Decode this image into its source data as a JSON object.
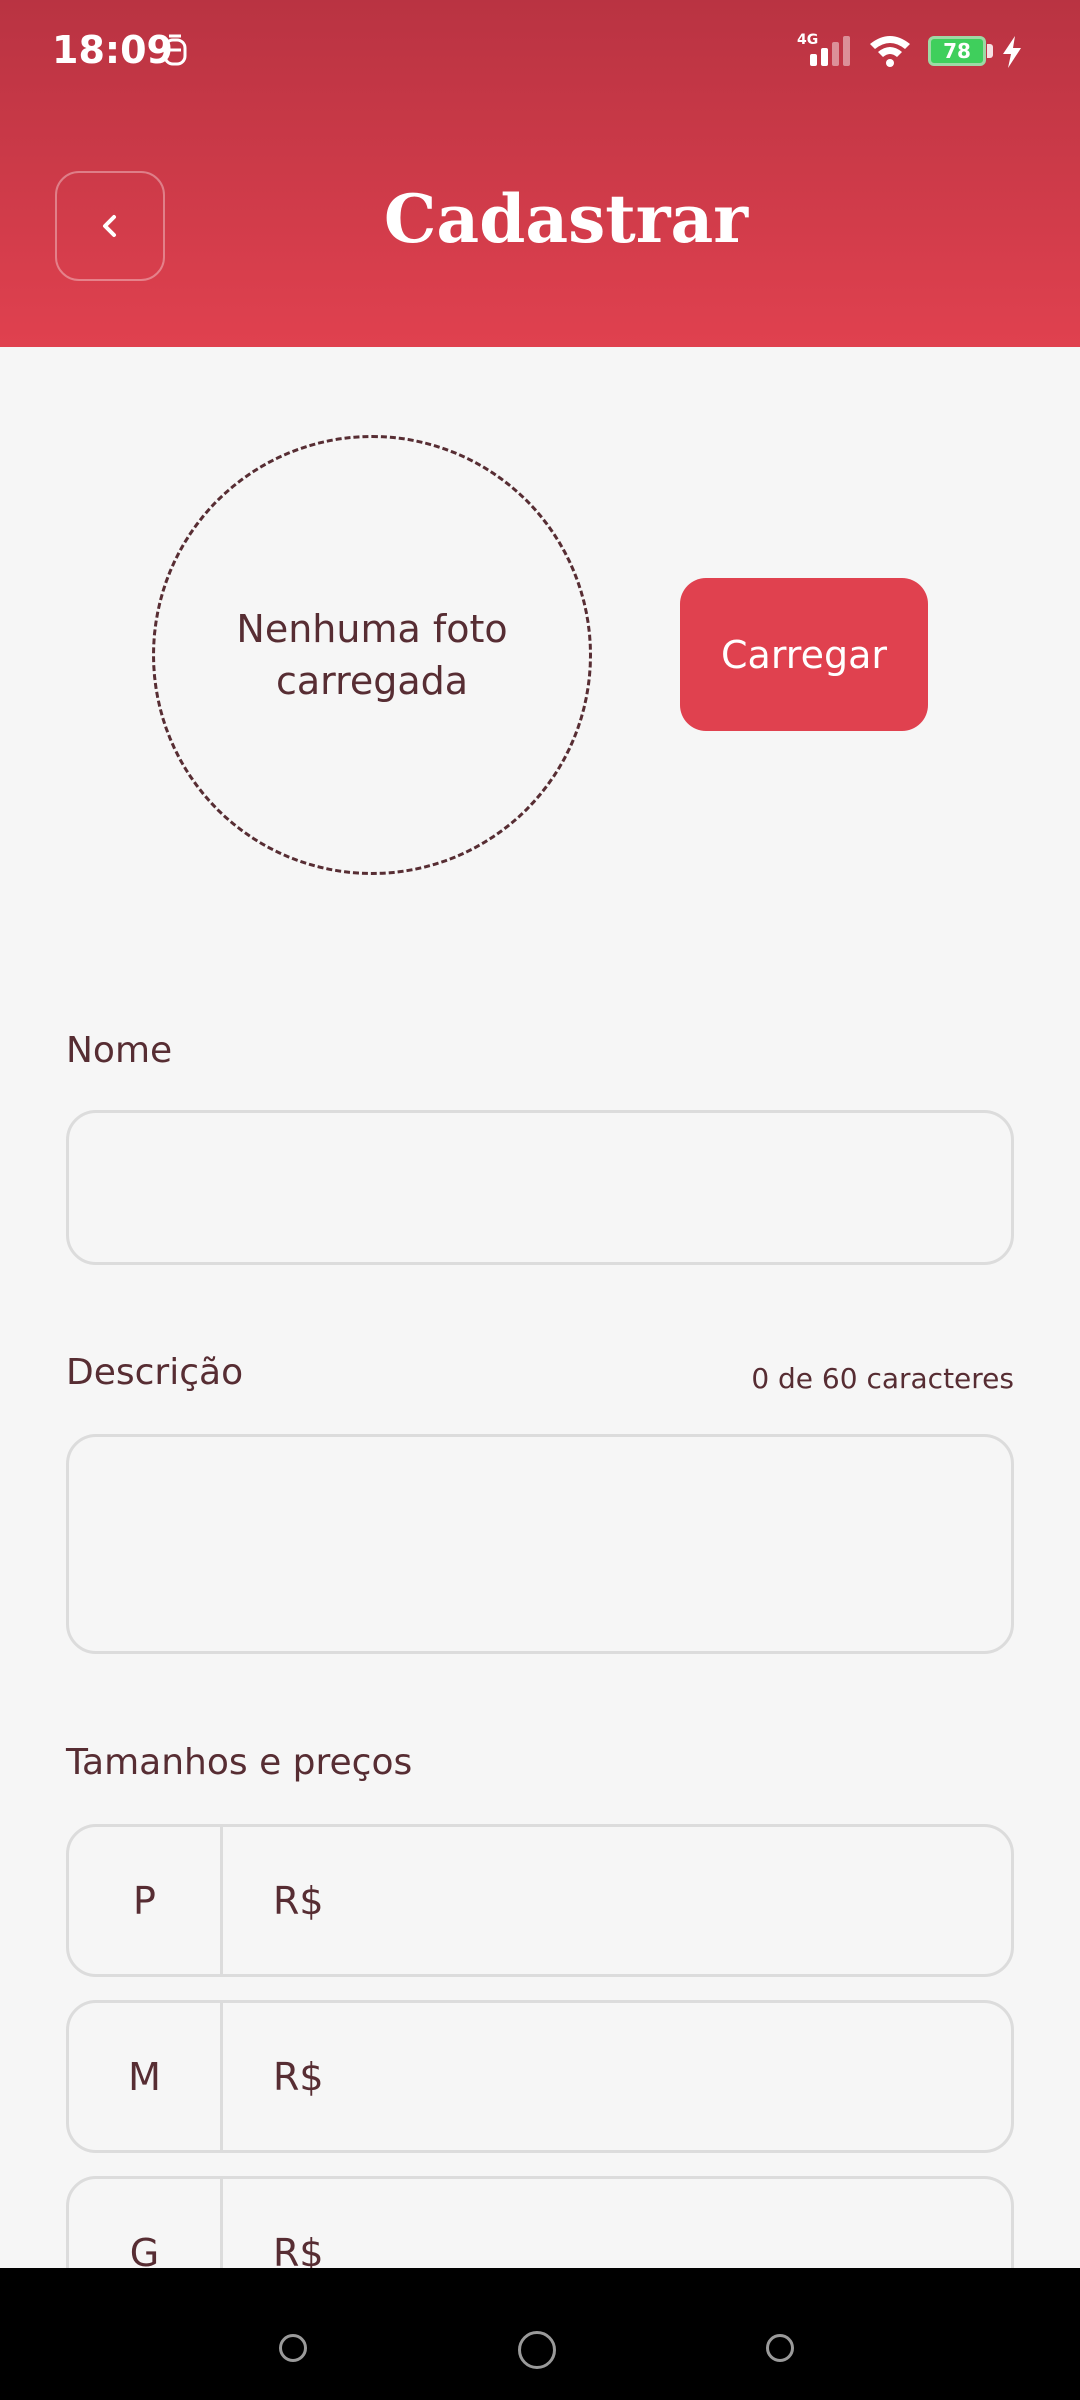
{
  "status_bar": {
    "time": "18:09",
    "network": "4G",
    "battery": "78"
  },
  "header": {
    "title": "Cadastrar"
  },
  "photo": {
    "placeholder_text": "Nenhuma foto carregada",
    "upload_label": "Carregar"
  },
  "form": {
    "name_label": "Nome",
    "name_value": "",
    "description_label": "Descrição",
    "description_counter": "0 de 60 caracteres",
    "description_value": "",
    "sizes_label": "Tamanhos e preços",
    "sizes": [
      {
        "size": "P",
        "currency": "R$"
      },
      {
        "size": "M",
        "currency": "R$"
      },
      {
        "size": "G",
        "currency": "R$"
      }
    ]
  },
  "colors": {
    "primary": "#e0414f",
    "header_top": "#b93342",
    "text": "#572d33",
    "background": "#f6f6f6"
  }
}
